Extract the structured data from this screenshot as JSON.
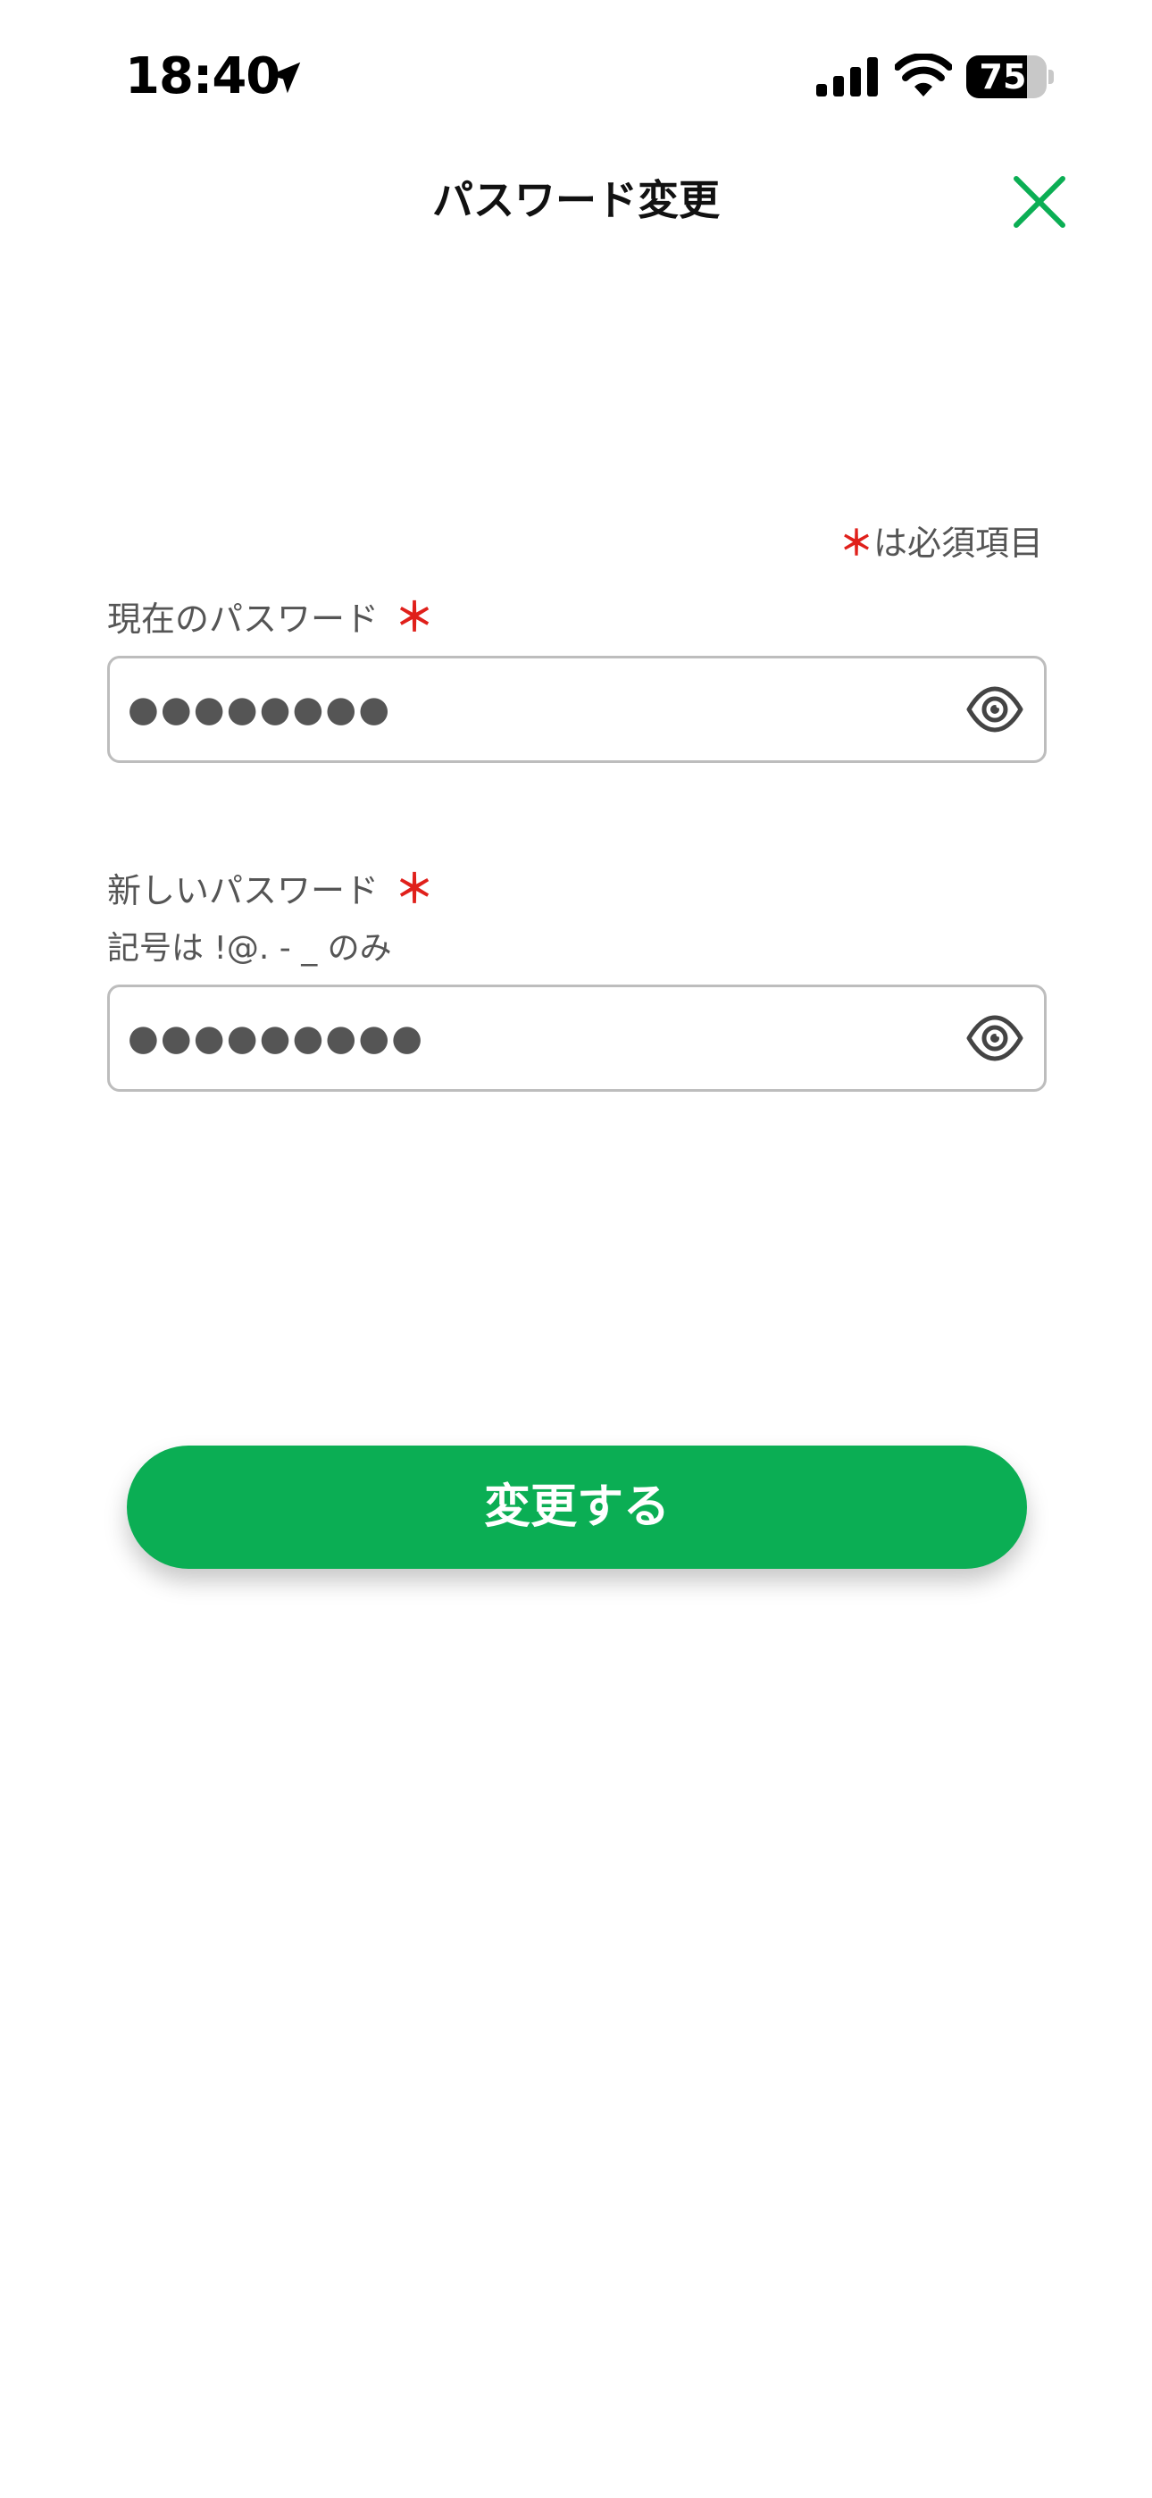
{
  "status_bar": {
    "time": "18:40",
    "battery_level": "75",
    "battery_fraction": 0.75
  },
  "header": {
    "title": "パスワード変更",
    "close_icon": "close-x-icon",
    "accent_color": "#0bae54"
  },
  "form": {
    "required_note": {
      "mark": "＊",
      "text": "は必須項目"
    },
    "current_password": {
      "label": "現在のパスワード",
      "required_mark": "＊",
      "value": "●●●●●●●●",
      "toggle_icon": "eye-icon"
    },
    "new_password": {
      "label": "新しいパスワード",
      "required_mark": "＊",
      "hint": "記号は !@. - _ のみ",
      "value": "●●●●●●●●●",
      "toggle_icon": "eye-icon"
    },
    "submit_label": "変更する"
  }
}
